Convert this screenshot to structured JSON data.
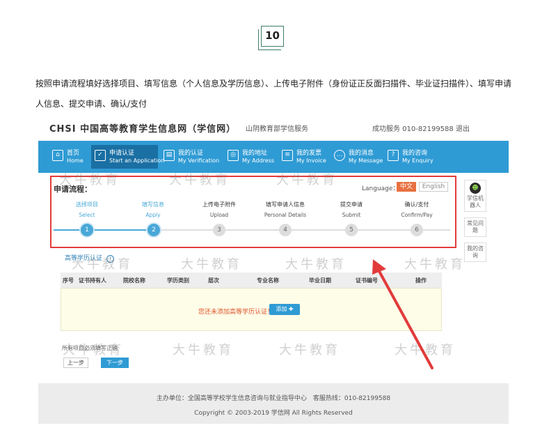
{
  "badge": "10",
  "intro": "按照申请流程填好选择项目、填写信息（个人信息及学历信息）、上传电子附件（身份证正反面扫描件、毕业证扫描件）、填写申请人信息、提交申请、确认/支付",
  "site_header": {
    "title": "CHSI 中国高等教育学生信息网（学信网）",
    "subtitle": "山阴教育部学信服务",
    "right": "成功服务 010-82199588 退出"
  },
  "nav": [
    {
      "zh": "首页",
      "en": "Home",
      "icon": "home-icon"
    },
    {
      "zh": "申请认证",
      "en": "Start an Application",
      "icon": "edit-icon",
      "active": true
    },
    {
      "zh": "我的认证",
      "en": "My Verification",
      "icon": "id-card-icon"
    },
    {
      "zh": "我的地址",
      "en": "My Address",
      "icon": "location-icon"
    },
    {
      "zh": "我的发票",
      "en": "My Invoice",
      "icon": "invoice-icon"
    },
    {
      "zh": "我的消息",
      "en": "My Message",
      "icon": "message-icon"
    },
    {
      "zh": "我的咨询",
      "en": "My Enquiry",
      "icon": "question-icon"
    }
  ],
  "flow": {
    "title": "申请流程：",
    "language_label": "Language：",
    "lang_zh": "中文",
    "lang_en": "English",
    "steps": [
      {
        "zh": "选择项目",
        "en": "Select",
        "num": "1",
        "done": true
      },
      {
        "zh": "填写信息",
        "en": "Apply",
        "num": "2",
        "done": true
      },
      {
        "zh": "上传电子附件",
        "en": "Upload",
        "num": "3",
        "done": false
      },
      {
        "zh": "填写申请人信息",
        "en": "Personal Details",
        "num": "4",
        "done": false
      },
      {
        "zh": "提交申请",
        "en": "Submit",
        "num": "5",
        "done": false
      },
      {
        "zh": "确认/支付",
        "en": "Confirm/Pay",
        "num": "6",
        "done": false
      }
    ]
  },
  "section_title": "高等学历认证",
  "table": {
    "headers": [
      "序号",
      "证书持有人",
      "院校名称",
      "学历类别",
      "层次",
      "专业名称",
      "毕业日期",
      "证书编号",
      "操作"
    ],
    "empty_message": "您还未添加高等学历认证！",
    "add_label": "添加"
  },
  "required_note": "所有项目必须填写正确",
  "prev_label": "上一步",
  "next_label": "下一步",
  "side": [
    {
      "label": "学信机器人"
    },
    {
      "label": "常见问题"
    },
    {
      "label": "我的咨询"
    }
  ],
  "footer": {
    "line1": "主办单位：全国高等学校学生信息咨询与就业指导中心　客服热线：010-82199588",
    "line2": "Copyright © 2003-2019 学信网 All Rights Reserved"
  },
  "watermark": "大牛教育",
  "colors": {
    "nav": "#2f9bd4",
    "highlight": "#e23b3b",
    "done": "#49a8d8"
  }
}
